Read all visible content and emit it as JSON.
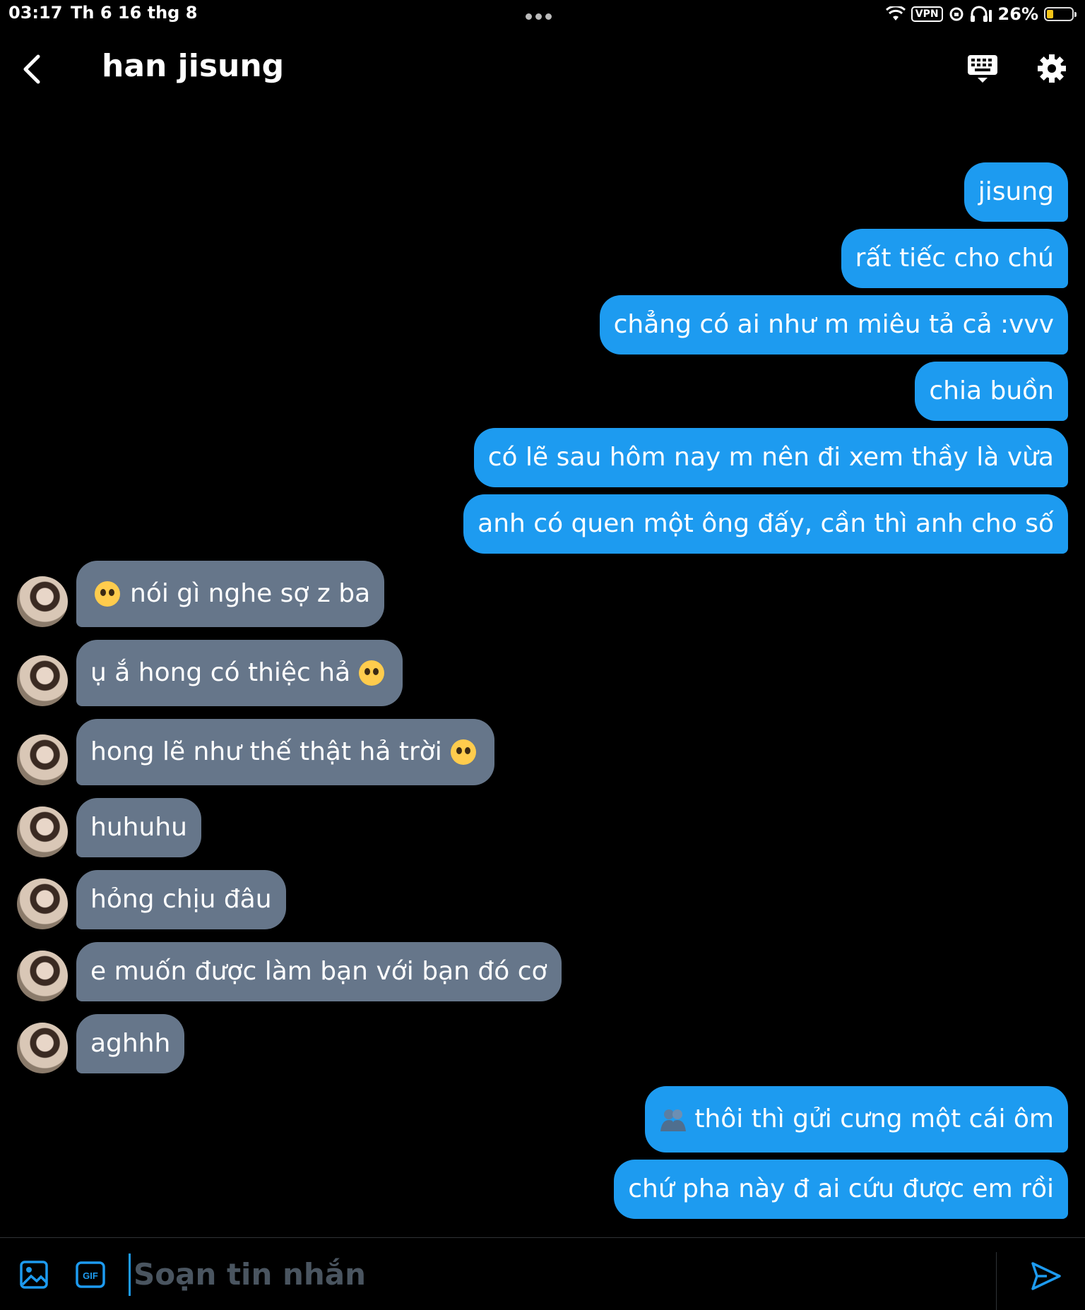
{
  "status_bar": {
    "time": "03:17",
    "date": "Th 6 16 thg 8",
    "vpn": "VPN",
    "battery": "26%",
    "battery_level": 0.26
  },
  "header": {
    "title": "han jisung",
    "icons": [
      "back-chevron-icon",
      "keyboard-icon",
      "gear-icon"
    ]
  },
  "messages": [
    {
      "side": "out",
      "text": "jisung"
    },
    {
      "side": "out",
      "text": "rất tiếc cho chú"
    },
    {
      "side": "out",
      "text": "chẳng có ai như m miêu tả cả :vvv"
    },
    {
      "side": "out",
      "text": "chia buồn"
    },
    {
      "side": "out",
      "text": "có lẽ sau hôm nay m nên đi xem thầy là vừa"
    },
    {
      "side": "out",
      "text": "anh có quen một ông đấy, cần thì anh cho số"
    },
    {
      "side": "in",
      "text": "nói gì nghe sợ z ba",
      "emoji_before": "😭"
    },
    {
      "side": "in",
      "text": "ụ ắ hong có thiệc hả",
      "emoji_after": "🥹"
    },
    {
      "side": "in",
      "text": "hong lẽ như thế thật hả trời",
      "emoji_after": "🥹"
    },
    {
      "side": "in",
      "text": "huhuhu"
    },
    {
      "side": "in",
      "text": "hỏng chịu đâu"
    },
    {
      "side": "in",
      "text": "e muốn được làm bạn với bạn đó cơ"
    },
    {
      "side": "in",
      "text": "aghhh"
    },
    {
      "side": "out",
      "text": "thôi thì gửi cưng một cái ôm",
      "emoji_before": "🫂"
    },
    {
      "side": "out",
      "text": "chứ pha này đ ai cứu được em rồi"
    }
  ],
  "composer": {
    "placeholder": "Soạn tin nhắn",
    "icons": [
      "image-icon",
      "gif-icon",
      "send-icon"
    ]
  },
  "colors": {
    "background": "#000000",
    "outgoing_bubble": "#1d9bf0",
    "incoming_bubble": "#66768a",
    "accent": "#1d9bf0"
  }
}
